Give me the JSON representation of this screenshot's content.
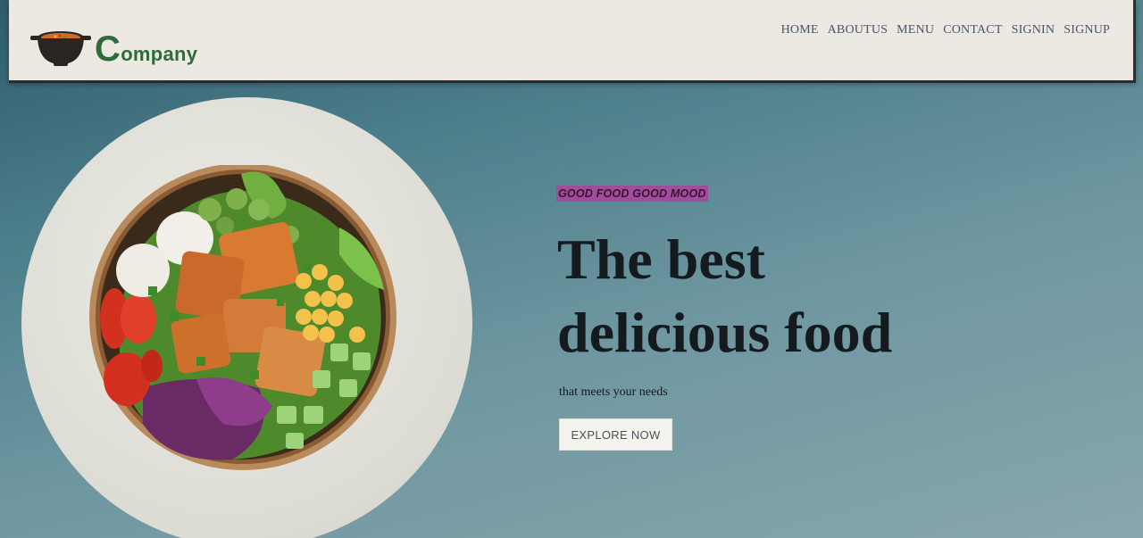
{
  "header": {
    "logo_initial": "C",
    "logo_rest": "ompany",
    "logo_icon": "cooking-pot-icon",
    "nav": [
      "HOME",
      "ABOUTUS",
      "MENU",
      "CONTACT",
      "SIGNIN",
      "SIGNUP"
    ]
  },
  "hero": {
    "tagline": "GOOD FOOD GOOD MOOD",
    "headline_line1": "The best",
    "headline_line2": "delicious food",
    "subtitle": "that meets your needs",
    "cta_label": "EXPLORE NOW",
    "image": "salad-bowl-image"
  },
  "colors": {
    "tagline_bg": "#a04e9a",
    "logo_green": "#2f6b3a",
    "header_bg": "#ebe9e1"
  }
}
